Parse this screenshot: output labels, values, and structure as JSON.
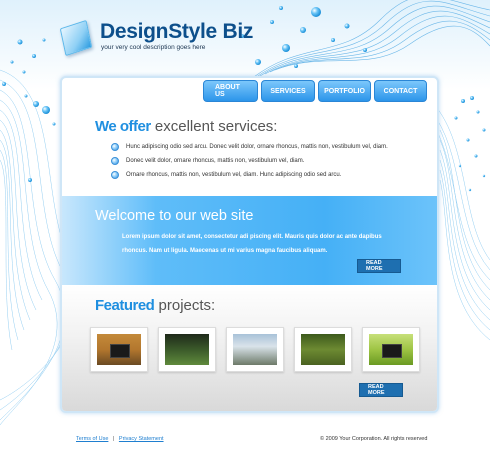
{
  "brand": {
    "name_part1": "DesignStyle",
    "name_part2": "Biz",
    "tagline": "your very cool description goes here"
  },
  "nav": {
    "items": [
      {
        "label": "ABOUT US"
      },
      {
        "label": "SERVICES"
      },
      {
        "label": "PORTFOLIO"
      },
      {
        "label": "CONTACT"
      }
    ]
  },
  "offer": {
    "title_highlight": "We offer",
    "title_rest": "excellent services:",
    "bullets": [
      "Hunc adipiscing odio sed arcu. Donec velit dolor, ornare rhoncus, mattis non, vestibulum vel, diam.",
      "Donec velit dolor, ornare rhoncus, mattis non, vestibulum vel, diam.",
      "Ornare rhoncus, mattis non, vestibulum vel, diam. Hunc adipiscing odio sed arcu."
    ]
  },
  "welcome": {
    "title": "Welcome to our web site",
    "text": "Lorem ipsum dolor sit amet, consectetur adi piscing elit. Mauris quis dolor ac ante dapibus rhoncus. Nam ut ligula. Maecenas ut mi varius magna faucibus aliquam.",
    "read_more": "READ MORE"
  },
  "featured": {
    "title_highlight": "Featured",
    "title_rest": "projects:",
    "read_more": "READ MORE"
  },
  "footer": {
    "terms": "Terms of Use",
    "separator": "|",
    "privacy": "Privacy Statement",
    "copyright": "© 2009 Your Corporation. All rights reserved"
  },
  "colors": {
    "accent": "#1f8fe0",
    "brand": "#0d4f8b",
    "button_dark": "#1e6fb0"
  }
}
